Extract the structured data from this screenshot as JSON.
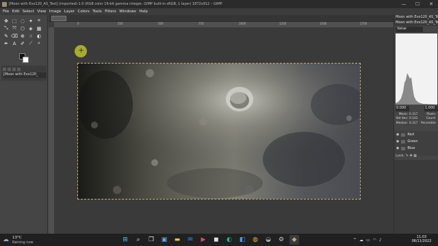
{
  "window": {
    "title": "[Moon with Evo120_AS_Test] (imported)-1.0 (RGB color 16-bit gamma integer, GIMP built-in sRGB, 1 layer) 1872x912 – GIMP",
    "controls": {
      "minimize": "—",
      "maximize": "☐",
      "close": "✕"
    }
  },
  "menu": [
    "File",
    "Edit",
    "Select",
    "View",
    "Image",
    "Layer",
    "Colors",
    "Tools",
    "Filters",
    "Windows",
    "Help"
  ],
  "toolbox": {
    "tools": [
      {
        "icon": "move-icon",
        "glyph": "✥"
      },
      {
        "icon": "rect-select-icon",
        "glyph": "⬚"
      },
      {
        "icon": "lasso-icon",
        "glyph": "◌"
      },
      {
        "icon": "fuzzy-select-icon",
        "glyph": "✦"
      },
      {
        "icon": "crop-icon",
        "glyph": "⌗"
      },
      {
        "icon": "transform-icon",
        "glyph": "⤡"
      },
      {
        "icon": "warp-icon",
        "glyph": "⤧"
      },
      {
        "icon": "cage-icon",
        "glyph": "⬡"
      },
      {
        "icon": "bucket-icon",
        "glyph": "◈"
      },
      {
        "icon": "gradient-icon",
        "glyph": "▦"
      },
      {
        "icon": "paintbrush-icon",
        "glyph": "✎"
      },
      {
        "icon": "eraser-icon",
        "glyph": "⌫"
      },
      {
        "icon": "clone-icon",
        "glyph": "⊕"
      },
      {
        "icon": "smudge-icon",
        "glyph": "☝"
      },
      {
        "icon": "dodge-icon",
        "glyph": "◐"
      },
      {
        "icon": "path-icon",
        "glyph": "✒"
      },
      {
        "icon": "text-icon",
        "glyph": "A"
      },
      {
        "icon": "color-picker-icon",
        "glyph": "✐"
      },
      {
        "icon": "measure-icon",
        "glyph": "⟋"
      },
      {
        "icon": "zoom-icon",
        "glyph": "⌕"
      }
    ],
    "image_entry": "[Moon with Evo120_"
  },
  "canvas": {
    "ruler_marks": [
      "0",
      "250",
      "500",
      "750",
      "1000",
      "1250",
      "1500",
      "1750"
    ]
  },
  "dock": {
    "top_title": "Moon with Evo120_AS_Test",
    "dialog_title": "Moon with Evo120_AS_Te",
    "channel_select": "Value",
    "range_low": "0.000",
    "range_high": "1.000",
    "stats": [
      {
        "k": "Mean:",
        "v": "0.317",
        "k2": "Pixels:"
      },
      {
        "k": "Std dev:",
        "v": "0.142",
        "k2": "Count:"
      },
      {
        "k": "Median:",
        "v": "0.317",
        "k2": "Percentile:"
      }
    ],
    "channels": [
      "Red",
      "Green",
      "Blue"
    ],
    "lock_label": "Lock:"
  },
  "taskbar": {
    "temp": "13°C",
    "weather": "Raining now",
    "time": "11:03",
    "date": "06/11/2022",
    "tray_up": "^"
  },
  "colors": {
    "accent": "#c7b36a",
    "histogram": "#8a8a8a"
  }
}
